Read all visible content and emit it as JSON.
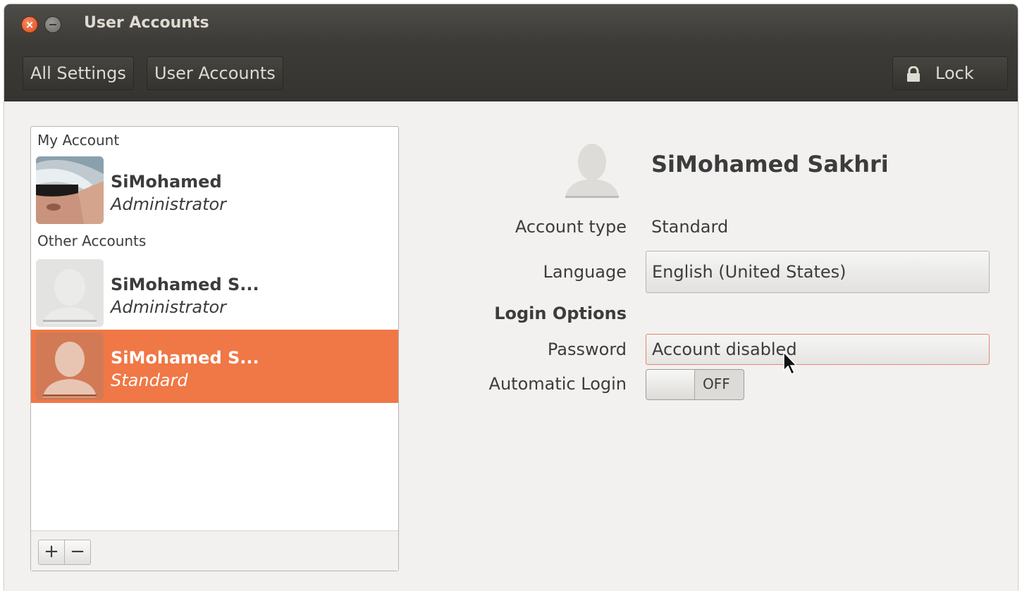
{
  "window": {
    "title": "User Accounts"
  },
  "toolbar": {
    "breadcrumbs": [
      "All Settings",
      "User Accounts"
    ],
    "lock_label": "Lock",
    "lock_icon": "lock-icon"
  },
  "accounts_list": {
    "section_my": "My Account",
    "section_other": "Other Accounts",
    "items": [
      {
        "name": "SiMohamed",
        "role": "Administrator",
        "selected": false,
        "avatar": "photo-avatar"
      },
      {
        "name": "SiMohamed S...",
        "role": "Administrator",
        "selected": false,
        "avatar": "default-avatar"
      },
      {
        "name": "SiMohamed S...",
        "role": "Standard",
        "selected": true,
        "avatar": "default-avatar"
      }
    ],
    "add_label": "+",
    "remove_label": "−"
  },
  "details": {
    "full_name": "SiMohamed Sakhri",
    "account_type_label": "Account type",
    "account_type_value": "Standard",
    "language_label": "Language",
    "language_value": "English (United States)",
    "login_options_heading": "Login Options",
    "password_label": "Password",
    "password_value": "Account disabled",
    "automatic_login_label": "Automatic Login",
    "automatic_login_state": "OFF"
  },
  "colors": {
    "accent": "#f07746",
    "titlebar": "#3c3b37",
    "window_bg": "#f2f1f0"
  }
}
